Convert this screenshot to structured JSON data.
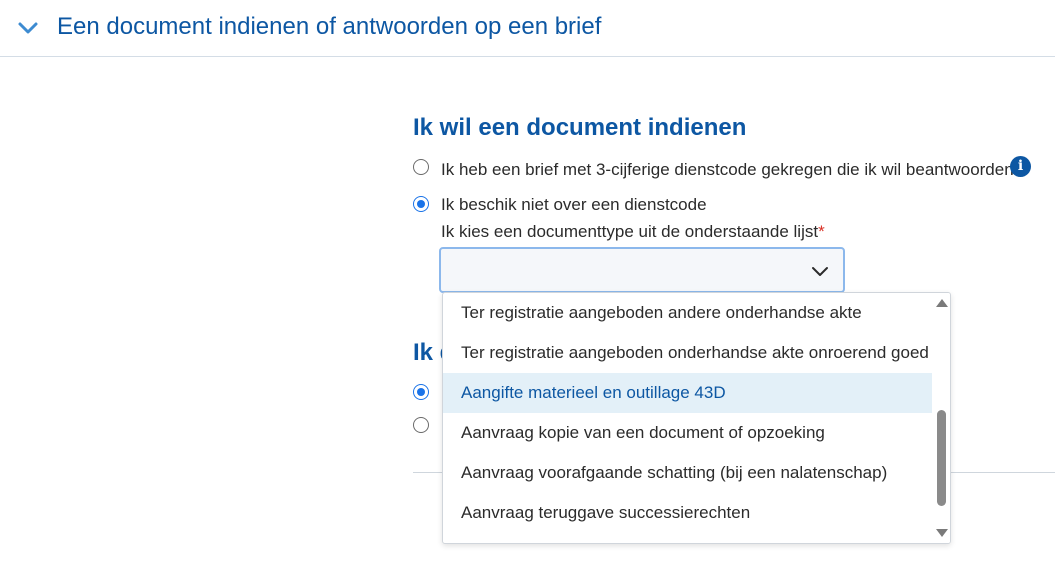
{
  "accordion": {
    "title": "Een document indienen of antwoorden op een brief",
    "expanded_icon": "chevron-down-icon"
  },
  "section": {
    "title": "Ik wil een document indienen",
    "title_2_partial": "Ik d"
  },
  "radios": [
    {
      "label": "Ik heb een brief met 3-cijferige dienstcode gekregen die ik wil beantwoorden",
      "checked": false
    },
    {
      "label": "Ik beschik niet over een dienstcode",
      "checked": true
    }
  ],
  "radios_2": [
    {
      "checked": true
    },
    {
      "checked": false
    }
  ],
  "document_type": {
    "label": "Ik kies een documenttype uit de onderstaande lijst",
    "required_marker": "*",
    "selected_value": ""
  },
  "dropdown": {
    "options": [
      "Ter registratie aangeboden andere onderhandse akte",
      "Ter registratie aangeboden onderhandse akte onroerend goed",
      "Aangifte materieel en outillage 43D",
      "Aanvraag kopie van een document of opzoeking",
      "Aanvraag voorafgaande schatting (bij een nalatenschap)",
      "Aanvraag teruggave successierechten"
    ],
    "highlighted_index": 2
  },
  "colors": {
    "brand": "#0d57a3",
    "radio_accent": "#1a73e8",
    "highlight_bg": "#e3f0f8",
    "required": "#d93025"
  }
}
